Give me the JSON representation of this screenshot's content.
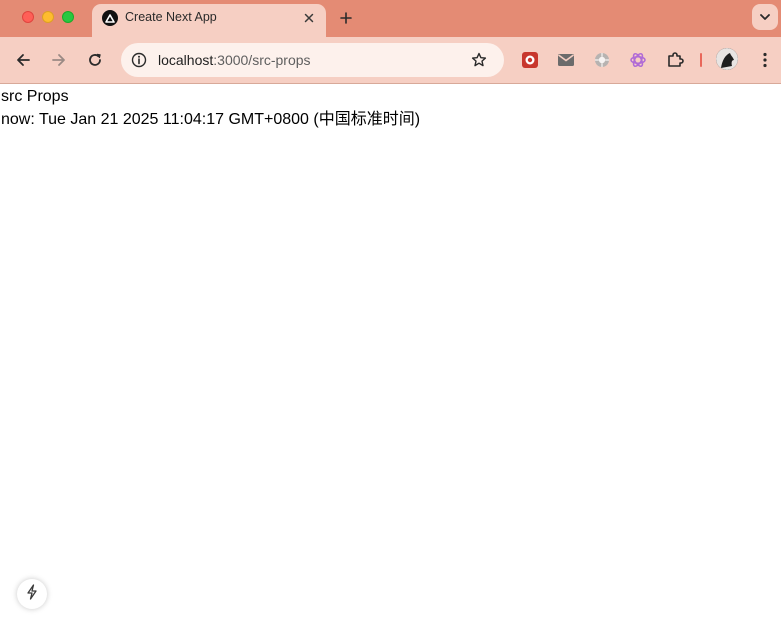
{
  "window": {
    "controls": [
      "close",
      "minimize",
      "maximize"
    ]
  },
  "tab": {
    "title": "Create Next App",
    "favicon": "nextjs-triangle-icon"
  },
  "address_bar": {
    "host": "localhost",
    "path": ":3000/src-props"
  },
  "toolbar": {
    "icons": [
      "back-icon",
      "forward-icon",
      "reload-icon",
      "site-info-icon",
      "bookmark-star-icon",
      "extension-red-icon",
      "gmail-icon",
      "extension-gray-icon",
      "openai-icon",
      "extensions-puzzle-icon",
      "profile-avatar",
      "menu-kebab-icon"
    ]
  },
  "page": {
    "heading": "src Props",
    "now_line": "now: Tue Jan 21 2025 11:04:17 GMT+0800 (中国标准时间)"
  },
  "dev_indicator": {
    "icon": "lightning-icon"
  },
  "colors": {
    "tabstrip": "#e48b74",
    "toolbar": "#f6cfc3",
    "omnibox": "#fdf1ec"
  }
}
